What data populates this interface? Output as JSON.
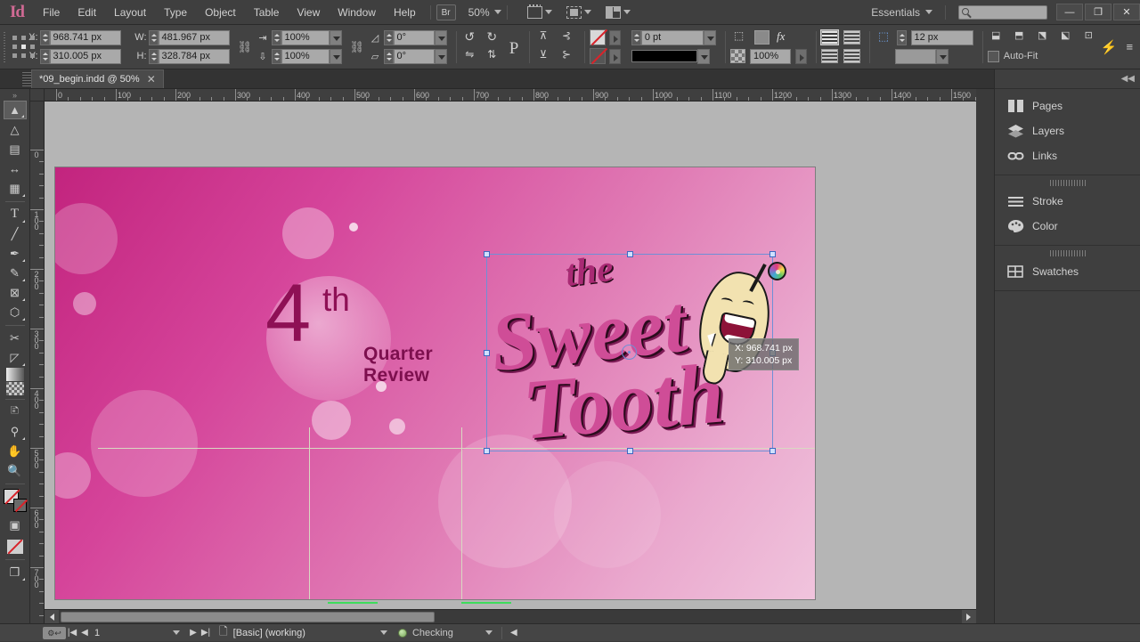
{
  "app": {
    "name": "Id",
    "workspace": "Essentials"
  },
  "menu": [
    "File",
    "Edit",
    "Layout",
    "Type",
    "Object",
    "Table",
    "View",
    "Window",
    "Help"
  ],
  "toolbar_top": {
    "bridge_label": "Br",
    "zoom_level": "50%",
    "view_icons": [
      "screen-mode-icon",
      "display-performance-icon",
      "panel-layout-icon"
    ],
    "search_placeholder": ""
  },
  "window_controls": {
    "minimize": "—",
    "maximize": "❐",
    "close": "✕"
  },
  "control_panel": {
    "x_label": "X:",
    "x_value": "968.741 px",
    "y_label": "Y:",
    "y_value": "310.005 px",
    "w_label": "W:",
    "w_value": "481.967 px",
    "h_label": "H:",
    "h_value": "328.784 px",
    "scale_x": "100%",
    "scale_y": "100%",
    "rotation": "0°",
    "shear": "0°",
    "stroke_weight": "0 pt",
    "opacity": "100%",
    "corner_radius": "12 px",
    "autofit_label": "Auto-Fit",
    "fx_label": "fx"
  },
  "document_tab": {
    "title": "*09_begin.indd @ 50%",
    "close": "✕"
  },
  "rulers": {
    "horizontal": [
      "0",
      "100",
      "200",
      "300",
      "400",
      "500",
      "600",
      "700",
      "800",
      "900",
      "1000",
      "1100",
      "1200",
      "1300",
      "1400",
      "1500"
    ],
    "vertical": [
      "0",
      "100",
      "200",
      "300",
      "400",
      "500",
      "600",
      "700"
    ],
    "unit": "px"
  },
  "tools": [
    {
      "name": "selection-tool",
      "glyph": "➤",
      "active": true
    },
    {
      "name": "direct-selection-tool",
      "glyph": "➤",
      "active": false
    },
    {
      "name": "page-tool",
      "glyph": "▤",
      "active": false
    },
    {
      "name": "gap-tool",
      "glyph": "↔",
      "active": false
    },
    {
      "name": "content-collector-tool",
      "glyph": "▦",
      "active": false
    },
    {
      "name": "type-tool",
      "glyph": "T",
      "active": false
    },
    {
      "name": "line-tool",
      "glyph": "╱",
      "active": false
    },
    {
      "name": "pen-tool",
      "glyph": "✒",
      "active": false
    },
    {
      "name": "pencil-tool",
      "glyph": "✎",
      "active": false
    },
    {
      "name": "rectangle-frame-tool",
      "glyph": "⊠",
      "active": false
    },
    {
      "name": "rectangle-tool",
      "glyph": "⬡",
      "active": false
    },
    {
      "name": "scissors-tool",
      "glyph": "✂",
      "active": false
    },
    {
      "name": "free-transform-tool",
      "glyph": "⬚",
      "active": false
    },
    {
      "name": "gradient-swatch-tool",
      "glyph": "▰",
      "active": false
    },
    {
      "name": "gradient-feather-tool",
      "glyph": "▨",
      "active": false
    },
    {
      "name": "note-tool",
      "glyph": "🗉",
      "active": false
    },
    {
      "name": "eyedropper-tool",
      "glyph": "⚲",
      "active": false
    },
    {
      "name": "hand-tool",
      "glyph": "✋",
      "active": false
    },
    {
      "name": "zoom-tool",
      "glyph": "🔍",
      "active": false
    }
  ],
  "document": {
    "heading_number": "4",
    "heading_ordinal": "th",
    "subtitle_line1": "Quarter",
    "subtitle_line2": "Review",
    "logo_word1": "the",
    "logo_word2": "Sweet",
    "logo_word3": "Tooth"
  },
  "tooltip": {
    "x": "X: 968.741 px",
    "y": "Y: 310.005 px"
  },
  "dock": {
    "groups": [
      {
        "items": [
          {
            "label": "Pages",
            "icon": "pages-icon"
          },
          {
            "label": "Layers",
            "icon": "layers-icon"
          },
          {
            "label": "Links",
            "icon": "links-icon"
          }
        ]
      },
      {
        "items": [
          {
            "label": "Stroke",
            "icon": "stroke-icon"
          },
          {
            "label": "Color",
            "icon": "color-icon"
          }
        ]
      },
      {
        "items": [
          {
            "label": "Swatches",
            "icon": "swatches-icon"
          }
        ]
      }
    ]
  },
  "status_bar": {
    "page_number": "1",
    "page_style": "[Basic] (working)",
    "preflight_status": "Checking"
  },
  "colors": {
    "accent": "#d06a94",
    "page_pink_dark": "#c2247e",
    "page_pink_light": "#f0c4dd",
    "heading_magenta": "#8e1055",
    "selection_blue": "#6f8fd6",
    "guide_green": "#3ddc5c",
    "none_red": "#d8232a"
  }
}
